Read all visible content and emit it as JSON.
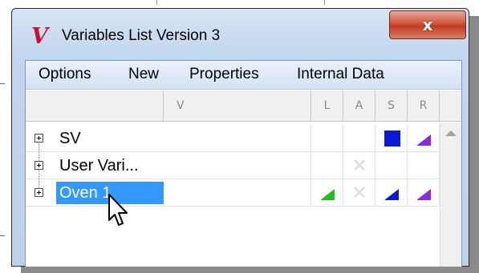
{
  "window": {
    "title": "Variables List Version 3",
    "app_icon": "V",
    "close_glyph": "x"
  },
  "menu": {
    "options": "Options",
    "new": "New",
    "properties": "Properties",
    "internal_data": "Internal Data"
  },
  "grid": {
    "headers": {
      "v": "V",
      "l": "L",
      "a": "A",
      "s": "S",
      "r": "R"
    },
    "rows": [
      {
        "name": "SV",
        "selected": false,
        "l": "",
        "a": "",
        "s": "square",
        "r": "triangle"
      },
      {
        "name": "User Vari...",
        "selected": false,
        "l": "",
        "a": "x",
        "s": "",
        "r": ""
      },
      {
        "name": "Oven 1",
        "selected": true,
        "l": "triangle",
        "a": "x",
        "s": "triangle",
        "r": "triangle"
      }
    ],
    "x_glyph": "✕"
  },
  "colors": {
    "selection": "#3399ff",
    "green": "#1fbf1f",
    "blue": "#0a18d8",
    "purple": "#8a2be2",
    "close_red": "#c03a20",
    "icon_red": "#c8102e"
  },
  "icons": {
    "expander": "plus-box-icon",
    "cursor": "arrow-cursor-icon",
    "scroll_up": "chevron-up-icon"
  }
}
